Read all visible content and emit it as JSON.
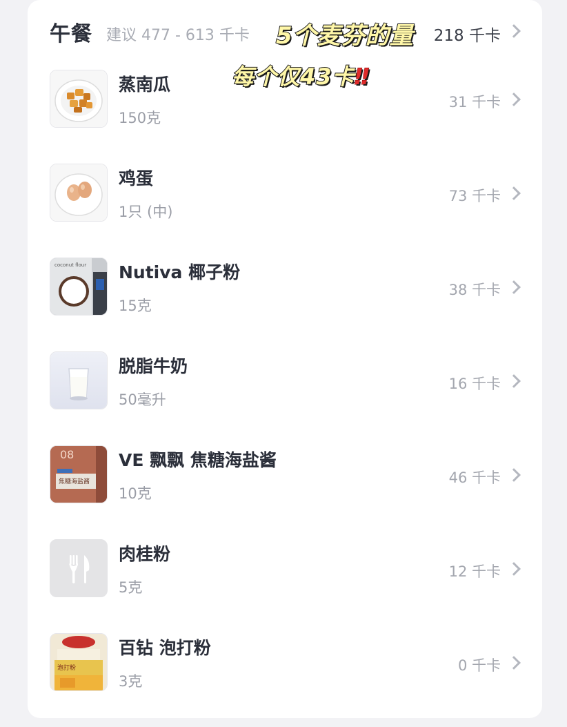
{
  "meal": {
    "title": "午餐",
    "suggestion": "建议 477 - 613 千卡",
    "total": "218 千卡"
  },
  "overlay": {
    "line1": "5个麦芬的量",
    "line2": "每个仅43卡",
    "line2_mark": "‼"
  },
  "colors": {
    "background": "#f2f2f5",
    "card": "#ffffff",
    "primary_text": "#2b2f3a",
    "secondary_text": "#9a9da6",
    "overlay_fill": "#fff7a8",
    "overlay_mark": "#e02b2b"
  },
  "items": [
    {
      "name": "蒸南瓜",
      "amount": "150克",
      "kcal": "31 千卡",
      "icon": "pumpkin-photo"
    },
    {
      "name": "鸡蛋",
      "amount": "1只 (中)",
      "kcal": "73 千卡",
      "icon": "eggs-photo"
    },
    {
      "name": "Nutiva 椰子粉",
      "amount": "15克",
      "kcal": "38 千卡",
      "icon": "coconut-flour-photo"
    },
    {
      "name": "脱脂牛奶",
      "amount": "50毫升",
      "kcal": "16 千卡",
      "icon": "milk-glass-photo"
    },
    {
      "name": "VE 飘飘 焦糖海盐酱",
      "amount": "10克",
      "kcal": "46 千卡",
      "icon": "caramel-sauce-photo"
    },
    {
      "name": "肉桂粉",
      "amount": "5克",
      "kcal": "12 千卡",
      "icon": "fork-knife-icon"
    },
    {
      "name": "百钻 泡打粉",
      "amount": "3克",
      "kcal": "0 千卡",
      "icon": "baking-powder-photo"
    }
  ]
}
